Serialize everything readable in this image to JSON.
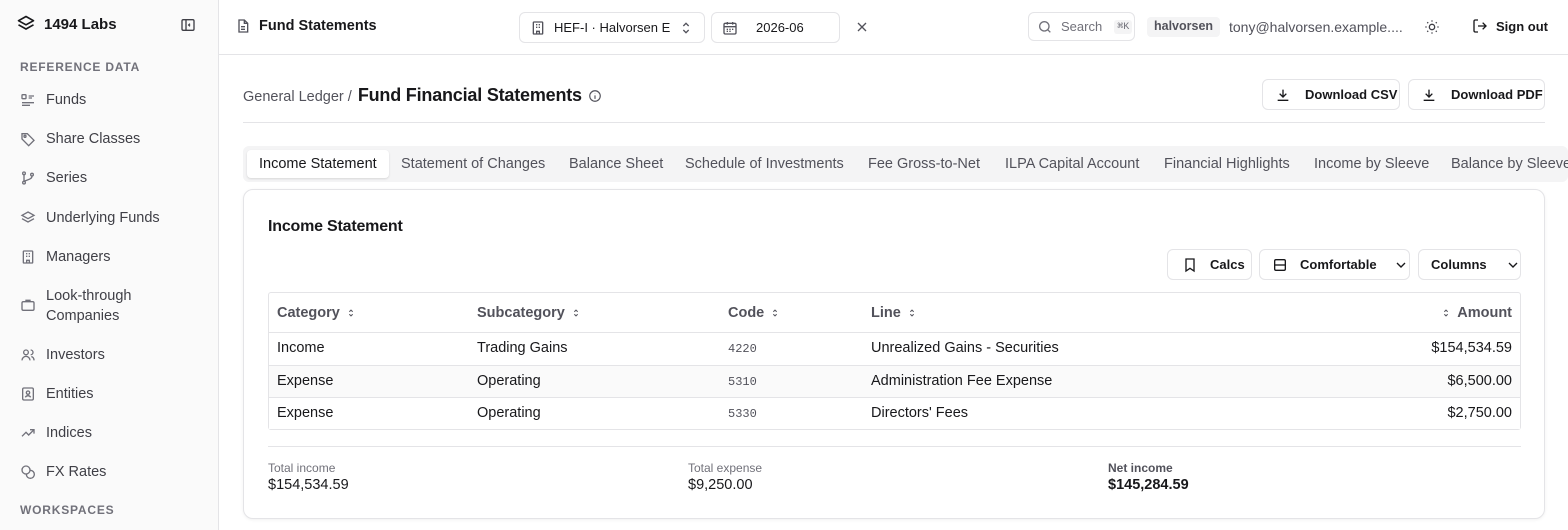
{
  "sidebar": {
    "brand": "1494 Labs",
    "section_reference": "REFERENCE DATA",
    "items": [
      {
        "label": "Funds",
        "icon": "funds-list-icon"
      },
      {
        "label": "Share Classes",
        "icon": "tag-icon"
      },
      {
        "label": "Series",
        "icon": "git-branch-icon"
      },
      {
        "label": "Underlying Funds",
        "icon": "layers-icon"
      },
      {
        "label": "Managers",
        "icon": "building-icon"
      },
      {
        "label": "Look-through Companies",
        "icon": "briefcase-icon"
      },
      {
        "label": "Investors",
        "icon": "users-icon"
      },
      {
        "label": "Entities",
        "icon": "id-card-icon"
      },
      {
        "label": "Indices",
        "icon": "trending-up-icon"
      },
      {
        "label": "FX Rates",
        "icon": "coins-icon"
      }
    ],
    "section_workspaces": "WORKSPACES"
  },
  "topbar": {
    "title": "Fund Statements",
    "fund_select": "HEF-I · Halvorsen E...",
    "period": "2026-06",
    "search_placeholder": "Search",
    "search_shortcut": "⌘K",
    "user_chip": "halvorsen",
    "email": "tony@halvorsen.example....",
    "sign_out": "Sign out"
  },
  "header": {
    "breadcrumb_parent": "General Ledger /",
    "title": "Fund Financial Statements",
    "download_csv": "Download CSV",
    "download_pdf": "Download PDF"
  },
  "tabs": [
    {
      "label": "Income Statement",
      "active": true
    },
    {
      "label": "Statement of Changes"
    },
    {
      "label": "Balance Sheet"
    },
    {
      "label": "Schedule of Investments"
    },
    {
      "label": "Fee Gross-to-Net"
    },
    {
      "label": "ILPA Capital Account"
    },
    {
      "label": "Financial Highlights"
    },
    {
      "label": "Income by Sleeve"
    },
    {
      "label": "Balance by Sleeve"
    }
  ],
  "card": {
    "title": "Income Statement",
    "calcs": "Calcs",
    "density": "Comfortable",
    "columns": "Columns"
  },
  "table": {
    "headers": [
      "Category",
      "Subcategory",
      "Code",
      "Line",
      "Amount"
    ],
    "rows": [
      {
        "category": "Income",
        "subcategory": "Trading Gains",
        "code": "4220",
        "line": "Unrealized Gains - Securities",
        "amount": "$154,534.59"
      },
      {
        "category": "Expense",
        "subcategory": "Operating",
        "code": "5310",
        "line": "Administration Fee Expense",
        "amount": "$6,500.00"
      },
      {
        "category": "Expense",
        "subcategory": "Operating",
        "code": "5330",
        "line": "Directors' Fees",
        "amount": "$2,750.00"
      }
    ]
  },
  "totals": {
    "income_label": "Total income",
    "income_value": "$154,534.59",
    "expense_label": "Total expense",
    "expense_value": "$9,250.00",
    "net_label": "Net income",
    "net_value": "$145,284.59"
  }
}
